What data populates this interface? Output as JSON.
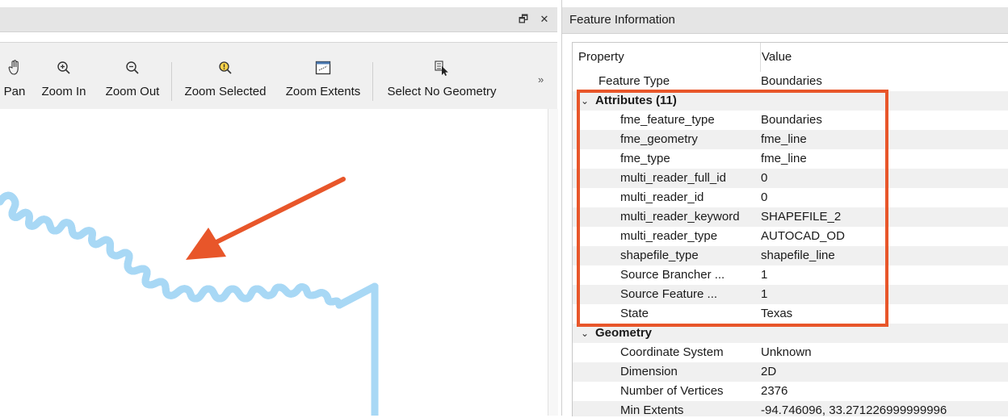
{
  "left_pane": {
    "toolbar": {
      "tools": [
        {
          "label": "Pan",
          "icon": "hand-icon"
        },
        {
          "label": "Zoom In",
          "icon": "zoom-in-icon"
        },
        {
          "label": "Zoom Out",
          "icon": "zoom-out-icon"
        },
        {
          "label": "Zoom Selected",
          "icon": "zoom-selected-icon"
        },
        {
          "label": "Zoom Extents",
          "icon": "zoom-extents-icon"
        },
        {
          "label": "Select No Geometry",
          "icon": "select-no-geometry-icon"
        }
      ],
      "overflow_glyph": "»"
    },
    "title_buttons": {
      "float_glyph": "🗗",
      "close_glyph": "✕"
    }
  },
  "right_pane": {
    "title": "Feature Information",
    "grid": {
      "columns": [
        "Property",
        "Value"
      ],
      "rows": [
        {
          "property": "Feature Type",
          "value": "Boundaries",
          "level": 1
        },
        {
          "property": "Attributes (11)",
          "value": "",
          "level": 0,
          "group": true,
          "expanded": true
        },
        {
          "property": "fme_feature_type",
          "value": "Boundaries",
          "level": 2
        },
        {
          "property": "fme_geometry",
          "value": "fme_line",
          "level": 2
        },
        {
          "property": "fme_type",
          "value": "fme_line",
          "level": 2
        },
        {
          "property": "multi_reader_full_id",
          "value": "0",
          "level": 2
        },
        {
          "property": "multi_reader_id",
          "value": "0",
          "level": 2
        },
        {
          "property": "multi_reader_keyword",
          "value": "SHAPEFILE_2",
          "level": 2
        },
        {
          "property": "multi_reader_type",
          "value": "AUTOCAD_OD",
          "level": 2
        },
        {
          "property": "shapefile_type",
          "value": "shapefile_line",
          "level": 2
        },
        {
          "property": "Source Brancher ...",
          "value": "1",
          "level": 2
        },
        {
          "property": "Source Feature ...",
          "value": "1",
          "level": 2
        },
        {
          "property": "State",
          "value": "Texas",
          "level": 2
        },
        {
          "property": "Geometry",
          "value": "",
          "level": 0,
          "group": true,
          "expanded": true
        },
        {
          "property": "Coordinate System",
          "value": "Unknown",
          "level": 2
        },
        {
          "property": "Dimension",
          "value": "2D",
          "level": 2
        },
        {
          "property": "Number of Vertices",
          "value": "2376",
          "level": 2
        },
        {
          "property": "Min Extents",
          "value": "-94.746096, 33.271226999999996",
          "level": 2
        }
      ]
    }
  },
  "colors": {
    "annotation": "#e8562a",
    "boundary_line": "#2e9be0",
    "boundary_highlight": "#a8d8f5"
  }
}
